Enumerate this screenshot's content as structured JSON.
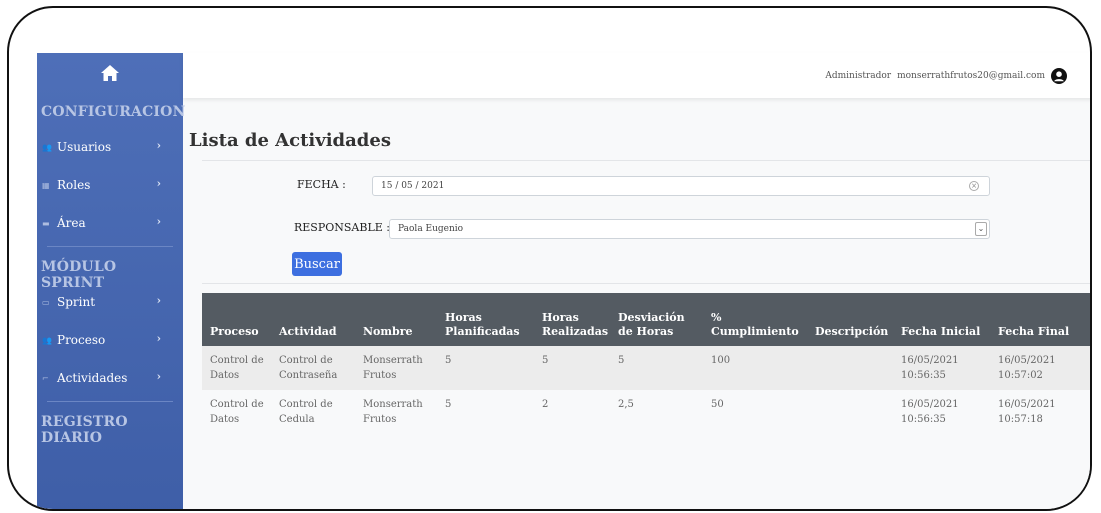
{
  "sidebar": {
    "sections": [
      {
        "heading": "CONFIGURACION",
        "items": [
          {
            "label": "Usuarios",
            "icon": "users-icon"
          },
          {
            "label": "Roles",
            "icon": "table-icon"
          },
          {
            "label": "Área",
            "icon": "folder-icon"
          }
        ]
      },
      {
        "heading": "MÓDULO SPRINT",
        "items": [
          {
            "label": "Sprint",
            "icon": "sprint-icon"
          },
          {
            "label": "Proceso",
            "icon": "users-icon"
          },
          {
            "label": "Actividades",
            "icon": "activity-icon"
          }
        ]
      },
      {
        "heading": "REGISTRO DIARIO",
        "items": []
      }
    ]
  },
  "topbar": {
    "role": "Administrador",
    "email": "monserrathfrutos20@gmail.com"
  },
  "page": {
    "title": "Lista de Actividades",
    "fecha_label": "FECHA :",
    "fecha_value": "15 / 05 / 2021",
    "responsable_label": "RESPONSABLE :",
    "responsable_value": "Paola Eugenio",
    "search_button": "Buscar"
  },
  "table": {
    "headers": [
      "Proceso",
      "Actividad",
      "Nombre",
      "Horas Planificadas",
      "Horas Realizadas",
      "Desviación de Horas",
      "% Cumplimiento",
      "Descripción",
      "Fecha Inicial",
      "Fecha Final"
    ],
    "rows": [
      [
        "Control de Datos",
        "Control de Contraseña",
        "Monserrath Frutos",
        "5",
        "5",
        "5",
        "100",
        "",
        "16/05/2021 10:56:35",
        "16/05/2021 10:57:02"
      ],
      [
        "Control de Datos",
        "Control de Cedula",
        "Monserrath Frutos",
        "5",
        "2",
        "2,5",
        "50",
        "",
        "16/05/2021 10:56:35",
        "16/05/2021 10:57:18"
      ]
    ]
  },
  "colors": {
    "sidebar": "#4466b0",
    "button": "#3d6fe0",
    "table_header": "#545b62"
  }
}
